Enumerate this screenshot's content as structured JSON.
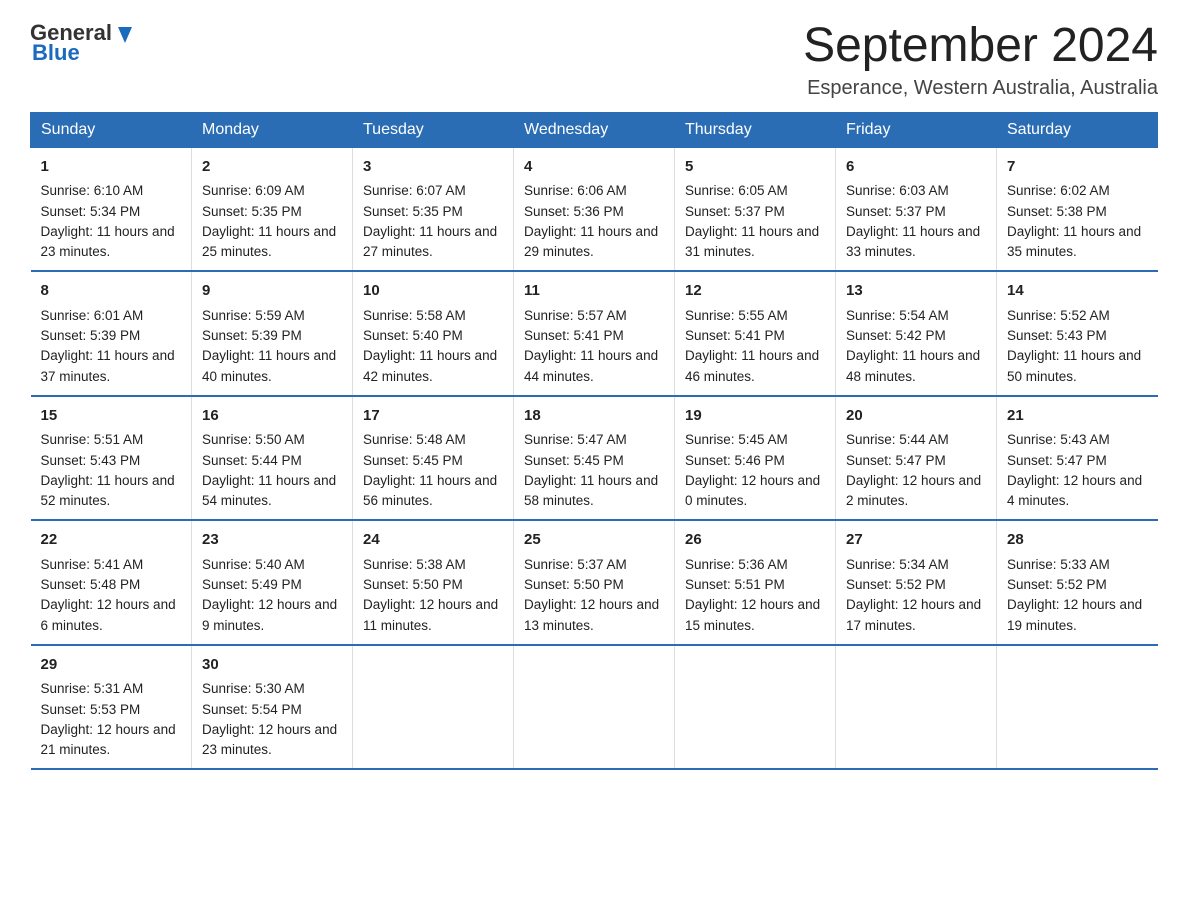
{
  "header": {
    "logo_general": "General",
    "logo_blue": "Blue",
    "title": "September 2024",
    "subtitle": "Esperance, Western Australia, Australia"
  },
  "days_of_week": [
    "Sunday",
    "Monday",
    "Tuesday",
    "Wednesday",
    "Thursday",
    "Friday",
    "Saturday"
  ],
  "weeks": [
    [
      {
        "day": "1",
        "sunrise": "6:10 AM",
        "sunset": "5:34 PM",
        "daylight": "11 hours and 23 minutes."
      },
      {
        "day": "2",
        "sunrise": "6:09 AM",
        "sunset": "5:35 PM",
        "daylight": "11 hours and 25 minutes."
      },
      {
        "day": "3",
        "sunrise": "6:07 AM",
        "sunset": "5:35 PM",
        "daylight": "11 hours and 27 minutes."
      },
      {
        "day": "4",
        "sunrise": "6:06 AM",
        "sunset": "5:36 PM",
        "daylight": "11 hours and 29 minutes."
      },
      {
        "day": "5",
        "sunrise": "6:05 AM",
        "sunset": "5:37 PM",
        "daylight": "11 hours and 31 minutes."
      },
      {
        "day": "6",
        "sunrise": "6:03 AM",
        "sunset": "5:37 PM",
        "daylight": "11 hours and 33 minutes."
      },
      {
        "day": "7",
        "sunrise": "6:02 AM",
        "sunset": "5:38 PM",
        "daylight": "11 hours and 35 minutes."
      }
    ],
    [
      {
        "day": "8",
        "sunrise": "6:01 AM",
        "sunset": "5:39 PM",
        "daylight": "11 hours and 37 minutes."
      },
      {
        "day": "9",
        "sunrise": "5:59 AM",
        "sunset": "5:39 PM",
        "daylight": "11 hours and 40 minutes."
      },
      {
        "day": "10",
        "sunrise": "5:58 AM",
        "sunset": "5:40 PM",
        "daylight": "11 hours and 42 minutes."
      },
      {
        "day": "11",
        "sunrise": "5:57 AM",
        "sunset": "5:41 PM",
        "daylight": "11 hours and 44 minutes."
      },
      {
        "day": "12",
        "sunrise": "5:55 AM",
        "sunset": "5:41 PM",
        "daylight": "11 hours and 46 minutes."
      },
      {
        "day": "13",
        "sunrise": "5:54 AM",
        "sunset": "5:42 PM",
        "daylight": "11 hours and 48 minutes."
      },
      {
        "day": "14",
        "sunrise": "5:52 AM",
        "sunset": "5:43 PM",
        "daylight": "11 hours and 50 minutes."
      }
    ],
    [
      {
        "day": "15",
        "sunrise": "5:51 AM",
        "sunset": "5:43 PM",
        "daylight": "11 hours and 52 minutes."
      },
      {
        "day": "16",
        "sunrise": "5:50 AM",
        "sunset": "5:44 PM",
        "daylight": "11 hours and 54 minutes."
      },
      {
        "day": "17",
        "sunrise": "5:48 AM",
        "sunset": "5:45 PM",
        "daylight": "11 hours and 56 minutes."
      },
      {
        "day": "18",
        "sunrise": "5:47 AM",
        "sunset": "5:45 PM",
        "daylight": "11 hours and 58 minutes."
      },
      {
        "day": "19",
        "sunrise": "5:45 AM",
        "sunset": "5:46 PM",
        "daylight": "12 hours and 0 minutes."
      },
      {
        "day": "20",
        "sunrise": "5:44 AM",
        "sunset": "5:47 PM",
        "daylight": "12 hours and 2 minutes."
      },
      {
        "day": "21",
        "sunrise": "5:43 AM",
        "sunset": "5:47 PM",
        "daylight": "12 hours and 4 minutes."
      }
    ],
    [
      {
        "day": "22",
        "sunrise": "5:41 AM",
        "sunset": "5:48 PM",
        "daylight": "12 hours and 6 minutes."
      },
      {
        "day": "23",
        "sunrise": "5:40 AM",
        "sunset": "5:49 PM",
        "daylight": "12 hours and 9 minutes."
      },
      {
        "day": "24",
        "sunrise": "5:38 AM",
        "sunset": "5:50 PM",
        "daylight": "12 hours and 11 minutes."
      },
      {
        "day": "25",
        "sunrise": "5:37 AM",
        "sunset": "5:50 PM",
        "daylight": "12 hours and 13 minutes."
      },
      {
        "day": "26",
        "sunrise": "5:36 AM",
        "sunset": "5:51 PM",
        "daylight": "12 hours and 15 minutes."
      },
      {
        "day": "27",
        "sunrise": "5:34 AM",
        "sunset": "5:52 PM",
        "daylight": "12 hours and 17 minutes."
      },
      {
        "day": "28",
        "sunrise": "5:33 AM",
        "sunset": "5:52 PM",
        "daylight": "12 hours and 19 minutes."
      }
    ],
    [
      {
        "day": "29",
        "sunrise": "5:31 AM",
        "sunset": "5:53 PM",
        "daylight": "12 hours and 21 minutes."
      },
      {
        "day": "30",
        "sunrise": "5:30 AM",
        "sunset": "5:54 PM",
        "daylight": "12 hours and 23 minutes."
      },
      null,
      null,
      null,
      null,
      null
    ]
  ],
  "labels": {
    "sunrise": "Sunrise:",
    "sunset": "Sunset:",
    "daylight": "Daylight:"
  }
}
